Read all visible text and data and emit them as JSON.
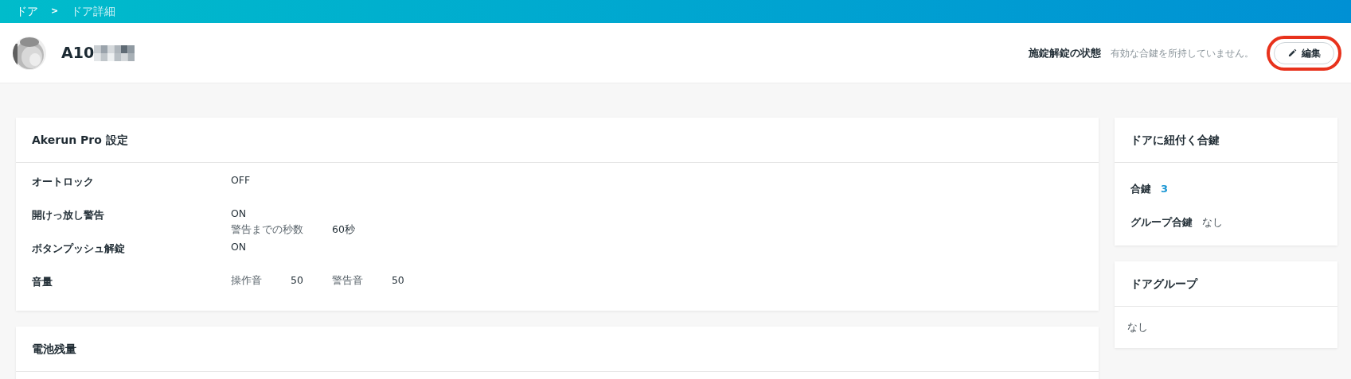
{
  "breadcrumb": [
    {
      "label": "ドア",
      "current": false
    },
    {
      "label": ">",
      "kind": "separator"
    },
    {
      "label": "ドア詳細",
      "current": true
    }
  ],
  "header": {
    "title": "A10",
    "redacted": true,
    "status_label": "施錠解錠の状態",
    "status_text": "有効な合鍵を所持していません。",
    "edit_button": "編集",
    "highlighted": true
  },
  "settings_card": {
    "title": "Akerun Pro 設定",
    "rows": [
      {
        "label": "オートロック",
        "lines": [
          [
            {
              "text": "OFF",
              "kind": "value"
            }
          ]
        ]
      },
      {
        "label": "開けっ放し警告",
        "lines": [
          [
            {
              "text": "ON",
              "kind": "value"
            }
          ],
          [
            {
              "text": "警告までの秒数",
              "kind": "label"
            },
            {
              "text": "60秒",
              "kind": "value"
            }
          ]
        ]
      },
      {
        "label": "ボタンプッシュ解錠",
        "lines": [
          [
            {
              "text": "ON",
              "kind": "value"
            }
          ]
        ]
      },
      {
        "label": "音量",
        "lines": [
          [
            {
              "text": "操作音",
              "kind": "label"
            },
            {
              "text": "50",
              "kind": "value"
            },
            {
              "text": "警告音",
              "kind": "label"
            },
            {
              "text": "50",
              "kind": "value"
            }
          ]
        ]
      }
    ]
  },
  "battery_card": {
    "title": "電池残量"
  },
  "keys_card": {
    "title": "ドアに紐付く合鍵",
    "rows": [
      {
        "label": "合鍵",
        "value": "3",
        "link": true
      },
      {
        "label": "グループ合鍵",
        "value": "なし",
        "link": false
      }
    ]
  },
  "group_card": {
    "title": "ドアグループ",
    "value": "なし"
  }
}
